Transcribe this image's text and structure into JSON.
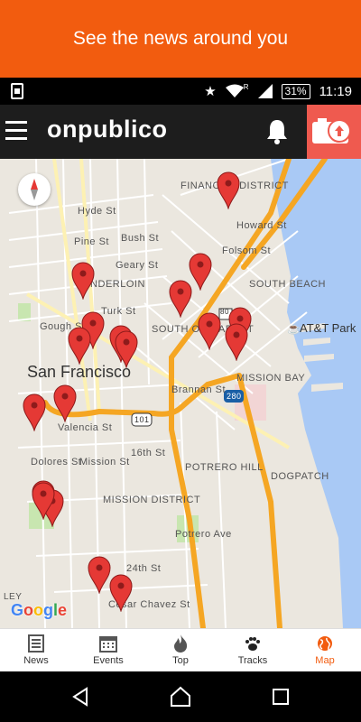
{
  "banner": {
    "text": "See the news around you"
  },
  "status_bar": {
    "battery": "31%",
    "time": "11:19",
    "roaming_flag": "R"
  },
  "app_bar": {
    "logo_text": "onpublico"
  },
  "map": {
    "city_label": "San Francisco",
    "districts": [
      "FINANCIAL DISTRICT",
      "TENDERLOIN",
      "SOUTH OF MARKET",
      "SOUTH BEACH",
      "MISSION BAY",
      "POTRERO HILL",
      "DOGPATCH",
      "MISSION DISTRICT"
    ],
    "streets": [
      "Hyde St",
      "Pine St",
      "Bush St",
      "Geary St",
      "Turk St",
      "Gough St",
      "Howard St",
      "Folsom St",
      "Brannan St",
      "Valencia St",
      "Mission St",
      "Dolores St",
      "16th St",
      "Potrero Ave",
      "24th St",
      "Cesar Chavez St"
    ],
    "poi": "AT&T Park",
    "highways": [
      "80",
      "280",
      "101"
    ],
    "attribution": "Google",
    "corner_fragment": "LEY",
    "pin_color": "#e53935",
    "pin_count": 23
  },
  "tabs": [
    {
      "label": "News",
      "icon": "newspaper-icon",
      "active": false
    },
    {
      "label": "Events",
      "icon": "calendar-icon",
      "active": false
    },
    {
      "label": "Top",
      "icon": "flame-icon",
      "active": false
    },
    {
      "label": "Tracks",
      "icon": "paw-icon",
      "active": false
    },
    {
      "label": "Map",
      "icon": "globe-icon",
      "active": true
    }
  ],
  "colors": {
    "brand_orange": "#f25c0f",
    "camera_button": "#ef5a4f",
    "app_bar": "#1d1d1d",
    "water": "#a9c9f5",
    "highway": "#f5a623"
  }
}
